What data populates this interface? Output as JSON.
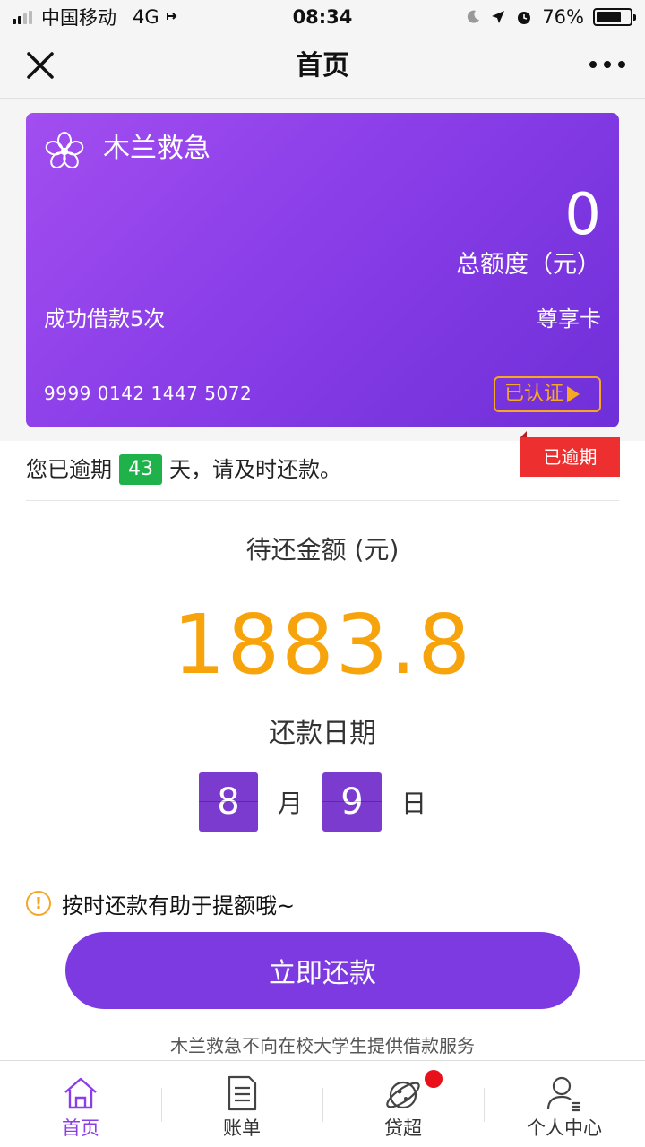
{
  "status_bar": {
    "carrier": "中国移动",
    "network": "4G",
    "time": "08:34",
    "battery_percent": "76%",
    "battery_level": 0.76
  },
  "nav": {
    "title": "首页",
    "close_icon": "close-icon",
    "more_icon": "more-icon"
  },
  "card": {
    "name": "木兰救急",
    "limit_value": "0",
    "limit_label": "总额度（元）",
    "success_count": "成功借款5次",
    "card_type": "尊享卡",
    "card_number": "9999 0142 1447 5072",
    "verified_label": "已认证",
    "colors": {
      "gradient_start": "#a24ef0",
      "gradient_end": "#6f2fd8",
      "accent": "#f7a823"
    }
  },
  "overdue": {
    "tag": "已逾期",
    "prefix": "您已逾期",
    "days": "43",
    "suffix": "天，请及时还款。"
  },
  "repayment": {
    "amount_label": "待还金额 (元)",
    "amount": "1883.8",
    "date_label": "还款日期",
    "month": "8",
    "month_unit": "月",
    "day": "9",
    "day_unit": "日"
  },
  "tip": {
    "text": "按时还款有助于提额哦~"
  },
  "repay_button": {
    "label": "立即还款"
  },
  "disclaimer": "木兰救急不向在校大学生提供借款服务",
  "tab_bar": {
    "items": [
      {
        "label": "首页",
        "icon": "home-icon",
        "active": true
      },
      {
        "label": "账单",
        "icon": "bill-icon",
        "active": false
      },
      {
        "label": "贷超",
        "icon": "planet-icon",
        "active": false,
        "badge": true
      },
      {
        "label": "个人中心",
        "icon": "user-icon",
        "active": false
      }
    ]
  }
}
